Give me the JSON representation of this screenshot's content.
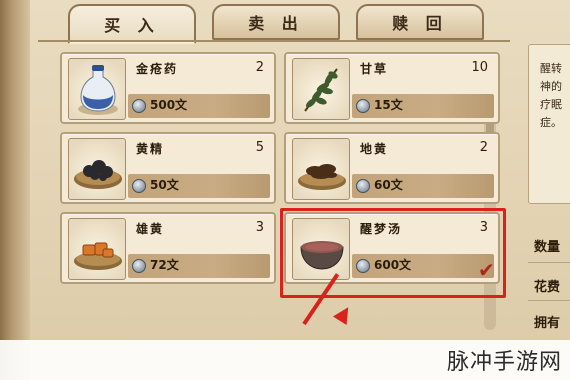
{
  "tabs": [
    {
      "label": "买 入",
      "active": true
    },
    {
      "label": "卖 出",
      "active": false
    },
    {
      "label": "赎 回",
      "active": false
    }
  ],
  "items": [
    {
      "name": "金疮药",
      "qty": "2",
      "price": "500文",
      "icon": "potion-bottle-icon"
    },
    {
      "name": "甘草",
      "qty": "10",
      "price": "15文",
      "icon": "herb-icon"
    },
    {
      "name": "黄精",
      "qty": "5",
      "price": "50文",
      "icon": "dark-herb-plate-icon"
    },
    {
      "name": "地黄",
      "qty": "2",
      "price": "60文",
      "icon": "root-plate-icon"
    },
    {
      "name": "雄黄",
      "qty": "3",
      "price": "72文",
      "icon": "mineral-plate-icon"
    },
    {
      "name": "醒梦汤",
      "qty": "3",
      "price": "600文",
      "icon": "soup-bowl-icon",
      "selected": true
    }
  ],
  "detail": {
    "text": "醒转神的疗眠症。"
  },
  "side": {
    "quantity_label": "数量",
    "flower_label": "花费",
    "owned_label": "拥有"
  },
  "watermark": "脉冲手游网",
  "colors": {
    "highlight": "#d8221c",
    "parchment": "#e9dcc0",
    "price_bar": "#c3a47a"
  }
}
